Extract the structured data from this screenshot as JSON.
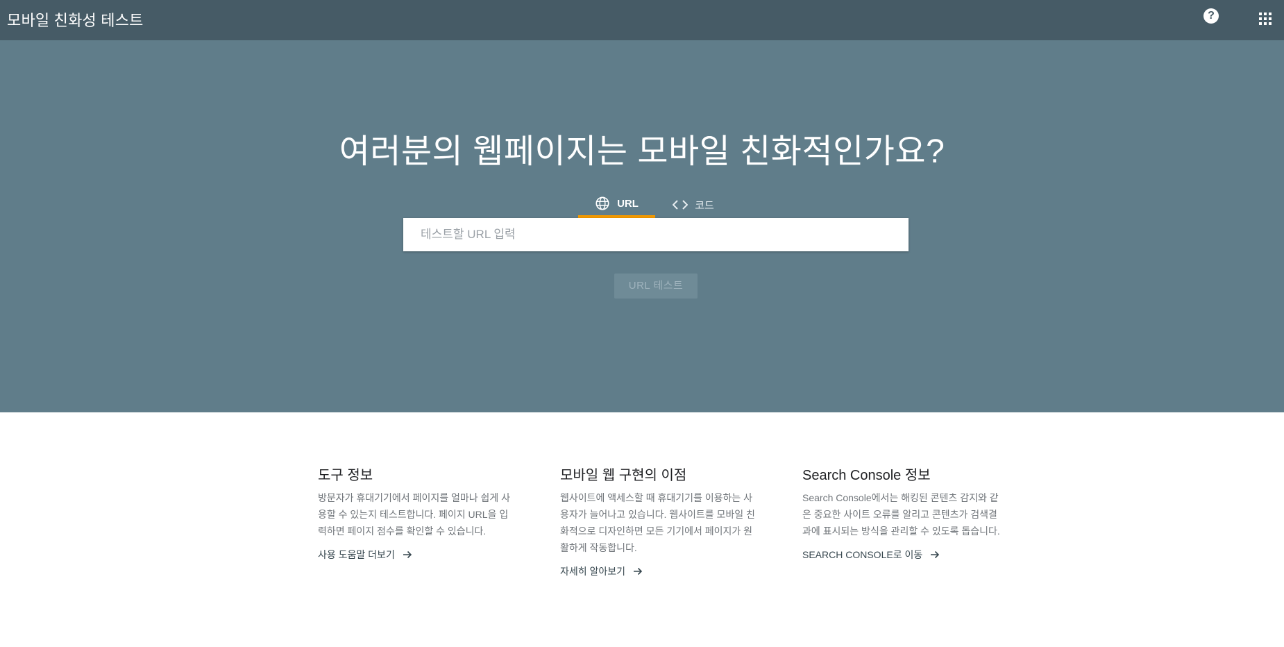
{
  "topbar": {
    "title": "모바일 친화성 테스트",
    "help_label": "?"
  },
  "hero": {
    "heading": "여러분의 웹페이지는 모바일 친화적인가요?",
    "tabs": [
      {
        "label": "URL",
        "icon": "globe-icon",
        "active": true
      },
      {
        "label": "코드",
        "icon": "code-icon",
        "active": false
      }
    ],
    "input_placeholder": "테스트할 URL 입력",
    "input_value": "",
    "test_button_label": "URL 테스트"
  },
  "info": [
    {
      "title": "도구 정보",
      "body": "방문자가 휴대기기에서 페이지를 얼마나 쉽게 사용할 수 있는지 테스트합니다. 페이지 URL을 입력하면 페이지 점수를 확인할 수 있습니다.",
      "link": "사용 도움말 더보기"
    },
    {
      "title": "모바일 웹 구현의 이점",
      "body": "웹사이트에 액세스할 때 휴대기기를 이용하는 사용자가 늘어나고 있습니다. 웹사이트를 모바일 친화적으로 디자인하면 모든 기기에서 페이지가 원활하게 작동합니다.",
      "link": "자세히 알아보기"
    },
    {
      "title": "Search Console 정보",
      "body": "Search Console에서는 해킹된 콘텐츠 감지와 같은 중요한 사이트 오류를 알리고 콘텐츠가 검색결과에 표시되는 방식을 관리할 수 있도록 돕습니다.",
      "link": "SEARCH CONSOLE로 이동"
    }
  ],
  "colors": {
    "topbar_bg": "#465b66",
    "hero_bg": "#607d8a",
    "tab_indicator": "#f29900"
  }
}
